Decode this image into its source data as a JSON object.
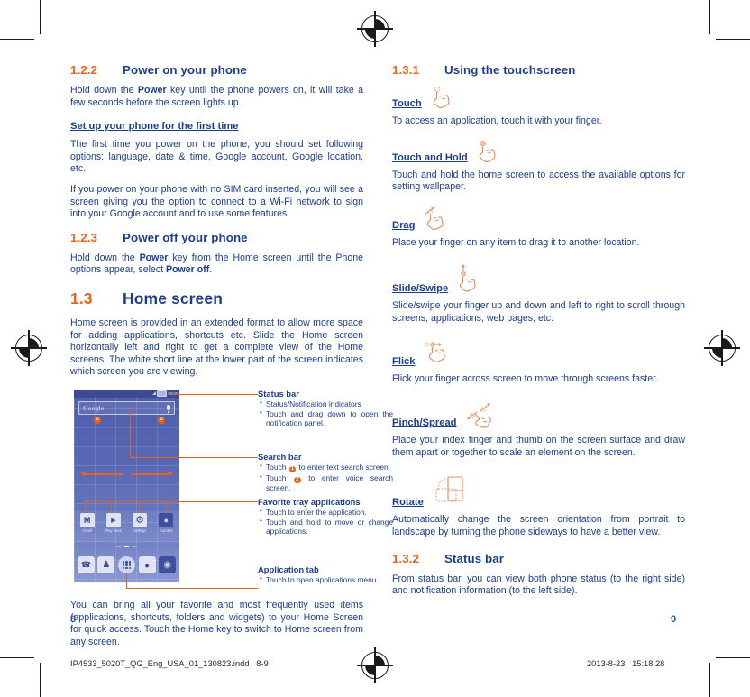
{
  "document": {
    "left_page_number": "8",
    "right_page_number": "9",
    "footer_filename": "IP4533_5020T_QG_Eng_USA_01_130823.indd   8-9",
    "footer_timestamp": "2013-8-23   15:18:28"
  },
  "left_column": {
    "section_122": {
      "number": "1.2.2",
      "title": "Power on your phone",
      "para1_a": "Hold down the ",
      "para1_b": "Power",
      "para1_c": " key until the phone powers on, it will take a few seconds before the screen lights up.",
      "subheading": "Set up your phone for the first time",
      "para2": "The first time you power on the phone, you should set following options: language, date & time, Google account, Google location, etc.",
      "para3": "If you power on your phone with no SIM card inserted, you will see a screen giving you the option to connect to a Wi-Fi network to sign into your Google account and to use some features."
    },
    "section_123": {
      "number": "1.2.3",
      "title": "Power off your phone",
      "para1_a": "Hold down the ",
      "para1_b": "Power",
      "para1_c": " key from the Home screen until the Phone options appear, select ",
      "para1_d": "Power off",
      "para1_e": "."
    },
    "section_13": {
      "number": "1.3",
      "title": "Home screen",
      "para1": "Home screen is provided in an extended format to allow more space for adding applications, shortcuts etc. Slide the Home screen horizontally left and right to get a complete view of the Home screens. The white short line at the lower part of the screen indicates which screen you are viewing."
    },
    "closing_para": "You can bring all your favorite and most frequently used items (applications, shortcuts, folders and widgets) to your Home Screen for quick access. Touch the Home key to switch to Home screen from any screen."
  },
  "phone_mock": {
    "status_bar_time": "00:00",
    "search_placeholder": "Google",
    "badge_one": "1",
    "badge_two": "2",
    "favorite_apps": [
      {
        "label": "Gmail",
        "icon": "gmail-icon",
        "glyph": "M"
      },
      {
        "label": "Play Store",
        "icon": "play-store-icon",
        "glyph": "▶"
      },
      {
        "label": "Settings",
        "icon": "settings-gear-icon",
        "glyph": "⚙"
      },
      {
        "label": "Camera",
        "icon": "camera-icon",
        "glyph": "●"
      }
    ],
    "dock_apps": [
      {
        "icon": "phone-icon",
        "glyph": "✆"
      },
      {
        "icon": "contacts-icon",
        "glyph": "♟"
      },
      {
        "icon": "app-drawer-icon",
        "glyph": ""
      },
      {
        "icon": "messages-icon",
        "glyph": "●"
      },
      {
        "icon": "browser-icon",
        "glyph": "◉"
      }
    ]
  },
  "callouts": [
    {
      "title": "Status bar",
      "items": [
        "Status/Notification indicators",
        "Touch and drag down to open the notification panel."
      ]
    },
    {
      "title": "Search bar",
      "items_rich": [
        {
          "pre": "Touch ",
          "badge": "1",
          "post": " to enter text search screen."
        },
        {
          "pre": "Touch ",
          "badge": "2",
          "post": " to enter voice search screen."
        }
      ]
    },
    {
      "title": "Favorite tray applications",
      "items": [
        "Touch to enter the application.",
        "Touch and hold to move or change applications."
      ]
    },
    {
      "title": "Application tab",
      "items": [
        "Touch to open applications menu."
      ]
    }
  ],
  "right_column": {
    "section_131": {
      "number": "1.3.1",
      "title": "Using the touchscreen"
    },
    "gestures": [
      {
        "name": "Touch",
        "icon": "touch-hand-icon",
        "description": "To access an application, touch it with your finger."
      },
      {
        "name": "Touch and Hold",
        "icon": "touch-and-hold-hand-icon",
        "description": "Touch and hold the home screen to access the available options for setting wallpaper."
      },
      {
        "name": "Drag",
        "icon": "drag-hand-icon",
        "description": "Place your finger on any item to drag it to another location."
      },
      {
        "name": "Slide/Swipe",
        "icon": "slide-swipe-hand-icon",
        "description": "Slide/swipe your finger up and down and left to right to scroll through screens, applications, web pages, etc."
      },
      {
        "name": "Flick",
        "icon": "flick-hand-icon",
        "description": "Flick your finger across screen to move through screens faster."
      },
      {
        "name": "Pinch/Spread",
        "icon": "pinch-spread-hand-icon",
        "description": "Place your index finger and thumb on the screen surface and draw them apart or together to scale an element on the screen."
      },
      {
        "name": "Rotate",
        "icon": "rotate-phone-icon",
        "description": "Automatically change the screen orientation from portrait to landscape by turning the phone sideways to have a better view."
      }
    ],
    "section_132": {
      "number": "1.3.2",
      "title": "Status bar",
      "para1": "From status bar, you can view both phone status (to the right side) and notification information (to the left side)."
    }
  },
  "colors": {
    "heading_blue": "#1b3d8f",
    "accent_orange": "#e8631a",
    "body_blue": "#1b3d8f",
    "page_number_blue": "#2e53a5"
  }
}
